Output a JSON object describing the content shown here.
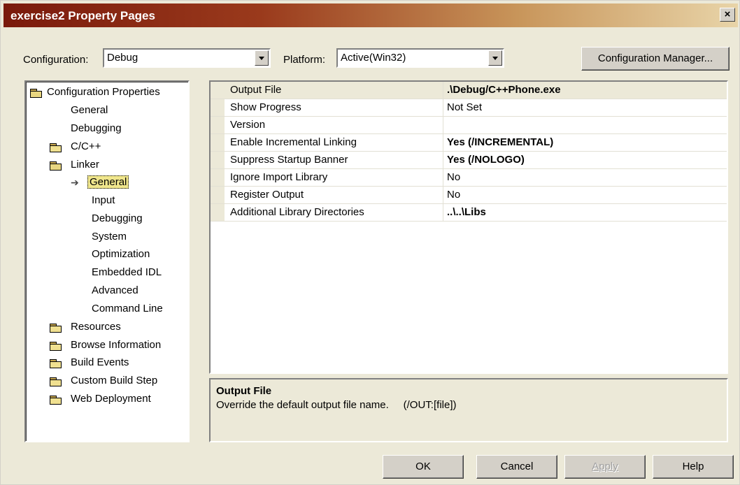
{
  "window": {
    "title": "exercise2 Property Pages",
    "close_glyph": "×"
  },
  "toolbar": {
    "configuration_label": "Configuration:",
    "configuration_value": "Debug",
    "platform_label": "Platform:",
    "platform_value": "Active(Win32)",
    "config_manager_label": "Configuration Manager..."
  },
  "tree": {
    "root": "Configuration Properties",
    "items": [
      {
        "label": "General"
      },
      {
        "label": "Debugging"
      },
      {
        "label": "C/C++"
      },
      {
        "label": "Linker"
      },
      {
        "label": "General"
      },
      {
        "label": "Input"
      },
      {
        "label": "Debugging"
      },
      {
        "label": "System"
      },
      {
        "label": "Optimization"
      },
      {
        "label": "Embedded IDL"
      },
      {
        "label": "Advanced"
      },
      {
        "label": "Command Line"
      },
      {
        "label": "Resources"
      },
      {
        "label": "Browse Information"
      },
      {
        "label": "Build Events"
      },
      {
        "label": "Custom Build Step"
      },
      {
        "label": "Web Deployment"
      }
    ],
    "selected": "General"
  },
  "properties": [
    {
      "name": "Output File",
      "value": ".\\Debug/C++Phone.exe",
      "bold": true
    },
    {
      "name": "Show Progress",
      "value": "Not Set",
      "bold": false
    },
    {
      "name": "Version",
      "value": "",
      "bold": false
    },
    {
      "name": "Enable Incremental Linking",
      "value": "Yes (/INCREMENTAL)",
      "bold": true
    },
    {
      "name": "Suppress Startup Banner",
      "value": "Yes (/NOLOGO)",
      "bold": true
    },
    {
      "name": "Ignore Import Library",
      "value": "No",
      "bold": false
    },
    {
      "name": "Register Output",
      "value": "No",
      "bold": false
    },
    {
      "name": "Additional Library Directories",
      "value": "..\\..\\Libs",
      "bold": true
    }
  ],
  "description": {
    "title": "Output File",
    "text": "Override the default output file name.     (/OUT:[file])"
  },
  "buttons": {
    "ok": "OK",
    "cancel": "Cancel",
    "apply": "Apply",
    "help": "Help"
  },
  "colors": {
    "face": "#ece9d8",
    "title_start": "#7a1a0c",
    "title_end": "#e8d4a8",
    "selection": "#f0e68c"
  }
}
